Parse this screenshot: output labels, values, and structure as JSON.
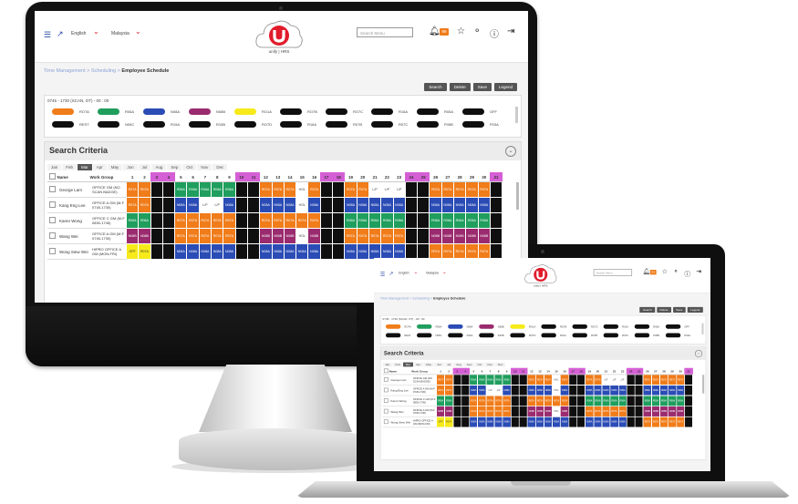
{
  "app": {
    "language": "English",
    "country": "Malaysia",
    "logo_text": "unify | HRS",
    "search_placeholder": "Search Menu",
    "notification_count": "99",
    "breadcrumb_root": "Time Management > Scheduling > ",
    "breadcrumb_current": "Employee Schedule",
    "actions": [
      "Search",
      "Delete",
      "Save",
      "Legend"
    ],
    "legend_title": "0745 - 1730 (SCAN, OT) - 00 : 00",
    "legend_items": [
      {
        "label": "ROTA",
        "color": "#f07c1a"
      },
      {
        "label": "R06A",
        "color": "#1f9e5d"
      },
      {
        "label": "N08A",
        "color": "#2b4cb5"
      },
      {
        "label": "N08B",
        "color": "#9a2b6e"
      },
      {
        "label": "RO1A",
        "color": "#f6ea1a"
      },
      {
        "label": "RO7B",
        "color": "#0f0f0f"
      },
      {
        "label": "RO7C",
        "color": "#0f0f0f"
      },
      {
        "label": "R16A",
        "color": "#0f0f0f"
      },
      {
        "label": "R05A",
        "color": "#0f0f0f"
      },
      {
        "label": "OFF",
        "color": "#0f0f0f"
      },
      {
        "label": "REST",
        "color": "#0f0f0f"
      },
      {
        "label": "N05C",
        "color": "#0f0f0f"
      },
      {
        "label": "R15A",
        "color": "#0f0f0f"
      },
      {
        "label": "R15B",
        "color": "#0f0f0f"
      },
      {
        "label": "RO7D",
        "color": "#0f0f0f"
      },
      {
        "label": "R16A",
        "color": "#0f0f0f"
      },
      {
        "label": "R07B",
        "color": "#0f0f0f"
      },
      {
        "label": "R07C",
        "color": "#0f0f0f"
      },
      {
        "label": "P05B",
        "color": "#0f0f0f"
      },
      {
        "label": "P03A",
        "color": "#0f0f0f"
      }
    ],
    "criteria_title": "Search Criteria",
    "months": [
      "Jan",
      "Feb",
      "Mar",
      "Apr",
      "May",
      "Jun",
      "Jul",
      "Aug",
      "Sep",
      "Oct",
      "Nov",
      "Dec"
    ],
    "active_month": "Mar",
    "col_name": "Name",
    "col_group": "Work Group",
    "days": [
      "1",
      "2",
      "3",
      "4",
      "5",
      "6",
      "7",
      "8",
      "9",
      "10",
      "11",
      "12",
      "13",
      "14",
      "15",
      "16",
      "17",
      "18",
      "19",
      "20",
      "21",
      "22",
      "23",
      "24",
      "25",
      "26",
      "27",
      "28",
      "29",
      "30",
      "31"
    ],
    "weekend_days": [
      "3",
      "4",
      "10",
      "11",
      "17",
      "18",
      "24",
      "25",
      "31"
    ],
    "rows": [
      {
        "name": "George Lam",
        "group": "OFFICE GM (NO SCAN BADGE)",
        "cells": [
          "orange:R07A",
          "orange:R07A",
          "black",
          "black",
          "green:R06A",
          "green:R06A",
          "green:R06A",
          "green:R06A",
          "green:R06A",
          "black",
          "black",
          "orange:R07A",
          "orange:R07A",
          "orange:R07A",
          "white:HOL",
          "orange:R07A",
          "black",
          "black",
          "orange:R07A",
          "orange:R07A",
          "white:L/P",
          "white:L/P",
          "white:L/P",
          "black",
          "black",
          "orange:R07A",
          "orange:R07A",
          "orange:R07A",
          "orange:R07A",
          "orange:R07A",
          "black"
        ]
      },
      {
        "name": "Kang Eng Lee",
        "group": "OFFICE A GM (M-F 0745-1730)",
        "cells": [
          "orange:R07A",
          "orange:R07A",
          "black",
          "black",
          "blue:N08A",
          "blue:N08A",
          "white:L/P",
          "white:L/P",
          "blue:N08A",
          "black",
          "black",
          "blue:N08A",
          "blue:N08A",
          "blue:N08A",
          "white:HOL",
          "blue:N08A",
          "black",
          "black",
          "blue:N08A",
          "blue:N08A",
          "blue:N08A",
          "blue:N08A",
          "blue:N08A",
          "black",
          "black",
          "blue:N08A",
          "blue:N08A",
          "blue:N08A",
          "blue:N08A",
          "blue:N08A",
          "black"
        ]
      },
      {
        "name": "Karen Wong",
        "group": "OFFICE C GM (M-F 0830-1745)",
        "cells": [
          "green:R06A",
          "green:R06A",
          "black",
          "black",
          "orange:R07A",
          "orange:R07A",
          "orange:R07A",
          "orange:R07A",
          "orange:R07A",
          "black",
          "black",
          "orange:R07A",
          "orange:R07A",
          "orange:R07A",
          "orange:R07A",
          "orange:R07A",
          "black",
          "black",
          "green:R06A",
          "green:R06A",
          "green:R06A",
          "green:R06A",
          "green:R06A",
          "black",
          "black",
          "green:R06A",
          "green:R06A",
          "green:R06A",
          "green:R06A",
          "green:R06A",
          "black"
        ]
      },
      {
        "name": "Wang Wei",
        "group": "OFFICE A GM (M-F 0745-1730)",
        "cells": [
          "purple:N08B",
          "purple:N08B",
          "black",
          "black",
          "orange:R07A",
          "orange:R07A",
          "orange:R07A",
          "orange:R07A",
          "orange:R07A",
          "black",
          "black",
          "purple:N08B",
          "purple:N08B",
          "purple:N08B",
          "white:HOL",
          "purple:N08B",
          "black",
          "black",
          "orange:R07A",
          "orange:R07A",
          "orange:R07A",
          "orange:R07A",
          "orange:R07A",
          "black",
          "black",
          "purple:N08B",
          "purple:N08B",
          "purple:N08B",
          "purple:N08B",
          "purple:N08B",
          "black"
        ]
      },
      {
        "name": "Wong Siew Wei",
        "group": "HIPRO OFFICE A GM (MON-FRI)",
        "cells": [
          "yellow:OFF",
          "yellow:R07A",
          "black",
          "black",
          "blue:N08A",
          "blue:N08A",
          "blue:N08A",
          "blue:N08A",
          "blue:N08A",
          "black",
          "black",
          "blue:N08A",
          "blue:N08A",
          "blue:N08A",
          "blue:N08A",
          "blue:N08A",
          "black",
          "black",
          "blue:N08A",
          "blue:N08A",
          "blue:N08A",
          "blue:N08A",
          "blue:N08A",
          "black",
          "black",
          "orange:R07A",
          "orange:R07A",
          "orange:R07A",
          "orange:R07A",
          "orange:R07A",
          "black"
        ]
      }
    ]
  }
}
